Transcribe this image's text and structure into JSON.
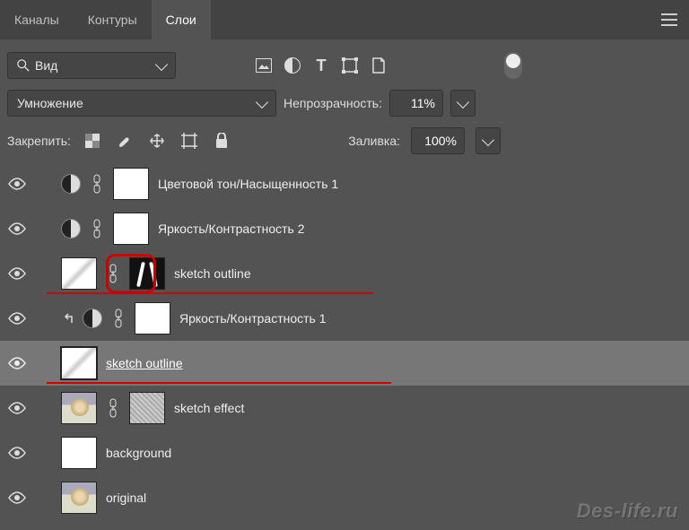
{
  "tabs": {
    "channels": "Каналы",
    "paths": "Контуры",
    "layers": "Слои"
  },
  "toolbar": {
    "view_label": "Вид",
    "blend_mode": "Умножение",
    "opacity_label": "Непрозрачность:",
    "opacity_value": "11%",
    "lock_label": "Закрепить:",
    "fill_label": "Заливка:",
    "fill_value": "100%"
  },
  "layers": [
    {
      "name": "Цветовой тон/Насыщенность 1"
    },
    {
      "name": "Яркость/Контрастность 2"
    },
    {
      "name": "sketch outline"
    },
    {
      "name": "Яркость/Контрастность 1"
    },
    {
      "name": "sketch outline"
    },
    {
      "name": "sketch effect"
    },
    {
      "name": "background"
    },
    {
      "name": "original"
    }
  ],
  "watermark": "Des-life.ru"
}
